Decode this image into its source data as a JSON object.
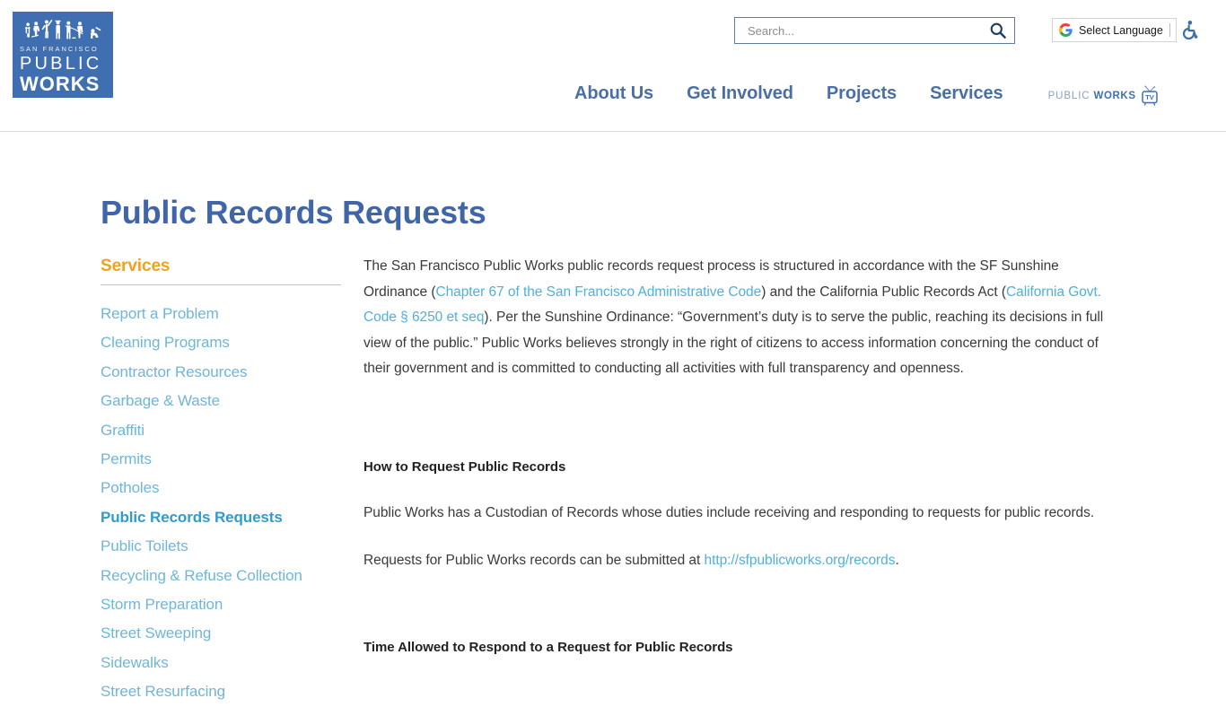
{
  "header": {
    "logo": {
      "line1": "SAN FRANCISCO",
      "line2": "PUBLIC",
      "line3": "WORKS",
      "bg_color": "#3f6fb0"
    },
    "search": {
      "placeholder": "Search...",
      "value": "",
      "button_icon": "search-icon"
    },
    "translate": {
      "label": "Select Language",
      "google_icon": "google-g-icon",
      "accessibility_icon": "wheelchair-accessibility-icon"
    },
    "nav": [
      {
        "label": "About Us"
      },
      {
        "label": "Get Involved"
      },
      {
        "label": "Projects"
      },
      {
        "label": "Services"
      }
    ],
    "pwtv": {
      "word1": "PUBLIC",
      "word2": "WORKS",
      "icon": "television-icon",
      "badge": "TV"
    }
  },
  "page": {
    "title": "Public Records Requests",
    "title_color": "#4066a8"
  },
  "sidebar": {
    "heading": "Services",
    "heading_color": "#f0a21c",
    "items": [
      {
        "label": "Report a Problem",
        "active": false
      },
      {
        "label": "Cleaning Programs",
        "active": false
      },
      {
        "label": "Contractor Resources",
        "active": false
      },
      {
        "label": "Garbage & Waste",
        "active": false
      },
      {
        "label": "Graffiti",
        "active": false
      },
      {
        "label": "Permits",
        "active": false
      },
      {
        "label": "Potholes",
        "active": false
      },
      {
        "label": "Public Records Requests",
        "active": true
      },
      {
        "label": "Public Toilets",
        "active": false
      },
      {
        "label": "Recycling & Refuse Collection",
        "active": false
      },
      {
        "label": "Storm Preparation",
        "active": false
      },
      {
        "label": "Street Sweeping",
        "active": false
      },
      {
        "label": "Sidewalks",
        "active": false
      },
      {
        "label": "Street Resurfacing",
        "active": false
      }
    ]
  },
  "main": {
    "intro": {
      "part1": "The San Francisco Public Works public records request process is structured in accordance with the SF Sunshine Ordinance (",
      "link1": "Chapter 67 of the San Francisco Administrative Code",
      "part2": ") and the California Public Records Act (",
      "link2": "California Govt. Code § 6250 et seq",
      "part3": "). Per the Sunshine Ordinance: “Government’s duty is to serve the public, reaching its decisions in full view of the public.” Public Works believes strongly in the right of citizens to access information concerning the conduct of their government and is committed to conducting all activities with full transparency and openness."
    },
    "section1": {
      "heading": "How to Request Public Records",
      "paragraph": "Public Works has a Custodian of Records whose duties include receiving and responding to requests for public records.",
      "submit_prefix": "Requests for Public Works records can be submitted at ",
      "submit_link": "http://sfpublicworks.org/records",
      "submit_suffix": "."
    },
    "section2": {
      "heading": "Time Allowed to Respond to a Request for Public Records"
    }
  }
}
